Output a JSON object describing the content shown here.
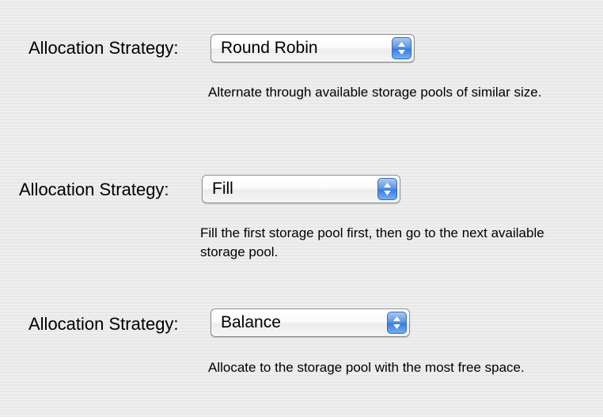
{
  "settings": [
    {
      "label": "Allocation Strategy:",
      "selected": "Round Robin",
      "description": "Alternate through available storage pools of similar size."
    },
    {
      "label": "Allocation Strategy:",
      "selected": "Fill",
      "description": "Fill the first storage pool first, then go to the next available storage pool."
    },
    {
      "label": "Allocation Strategy:",
      "selected": "Balance",
      "description": "Allocate to the storage pool with the most free space."
    }
  ],
  "icons": {
    "popup_arrows": "up-down-chevron-icon"
  },
  "colors": {
    "background": "#ececec",
    "popup_accent": "#3a7be0"
  }
}
